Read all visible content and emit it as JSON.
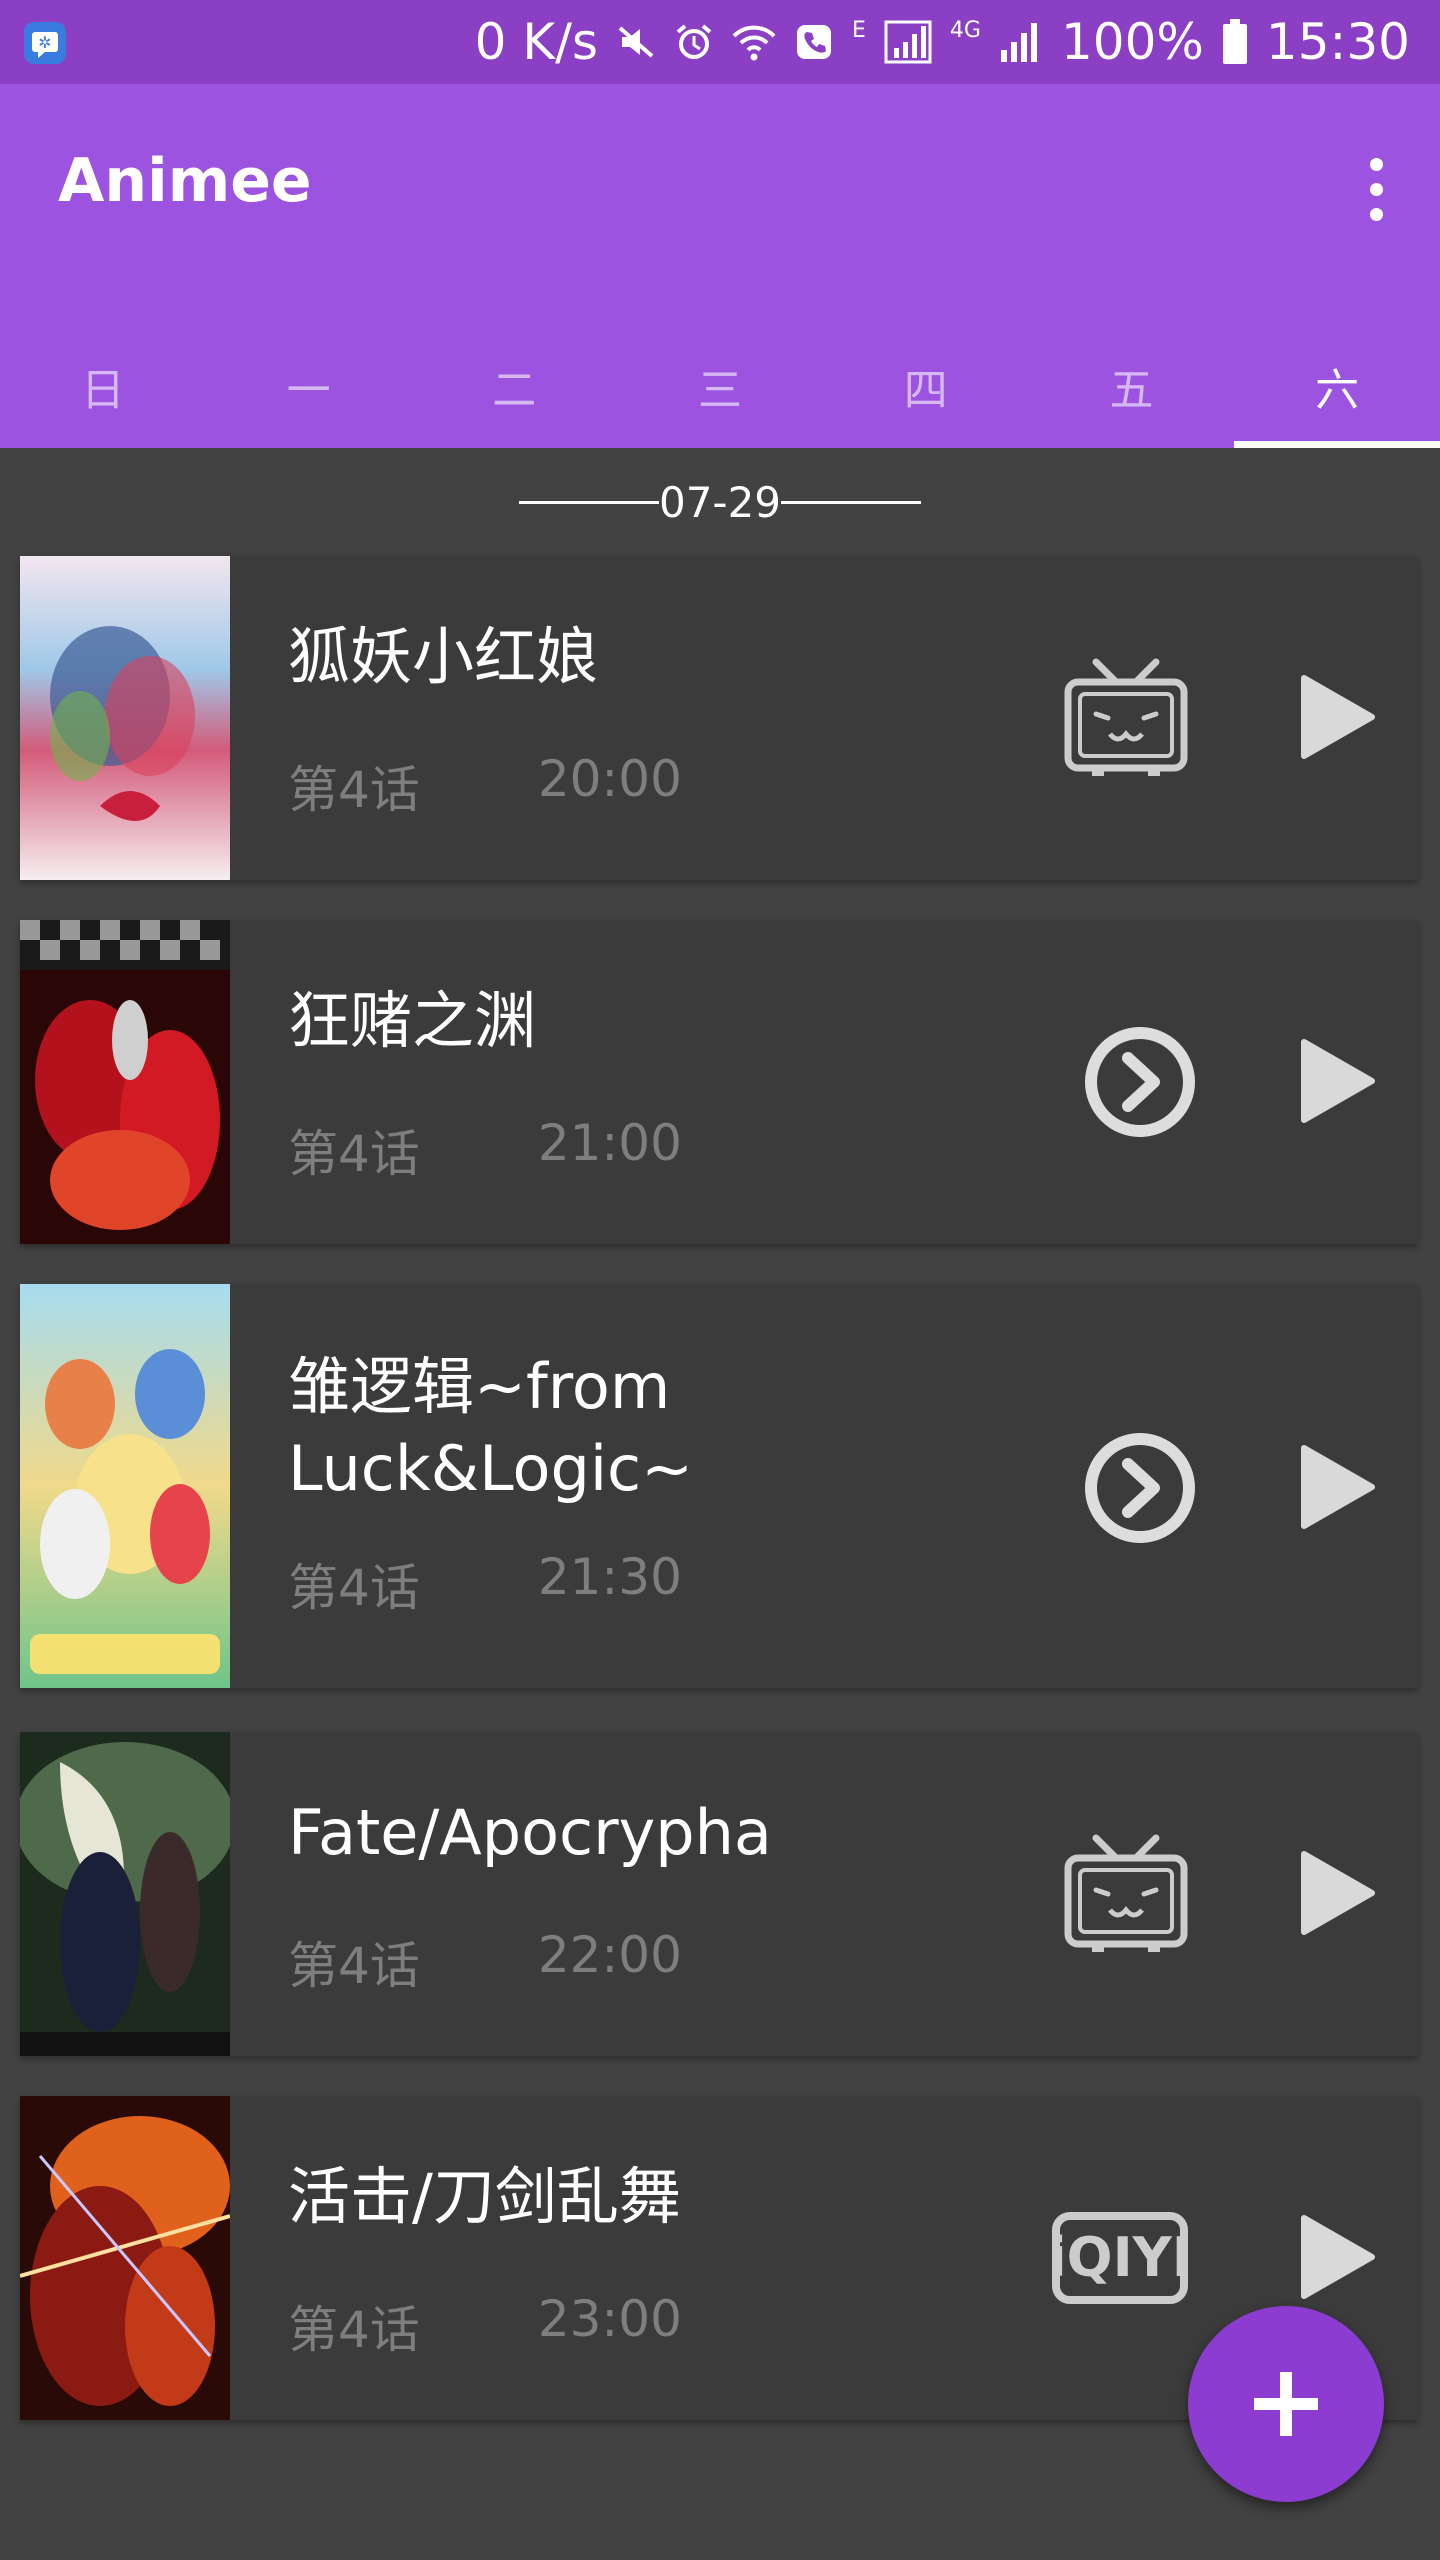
{
  "status_bar": {
    "speed": "0 K/s",
    "network_e": "E",
    "network_4g": "4G",
    "battery": "100%",
    "time": "15:30"
  },
  "app_bar": {
    "title": "Animee",
    "tabs": [
      "日",
      "一",
      "二",
      "三",
      "四",
      "五",
      "六"
    ],
    "active_tab": "六"
  },
  "date_header": "07-29",
  "anime_list": [
    {
      "title": "狐妖小红娘",
      "episode": "第4话",
      "time": "20:00",
      "platform": "bilibili-tv-icon"
    },
    {
      "title": "狂赌之渊",
      "episode": "第4话",
      "time": "21:00",
      "platform": "circle-play-icon"
    },
    {
      "title": "雏逻辑~from Luck&Logic~",
      "episode": "第4话",
      "time": "21:30",
      "platform": "circle-play-icon"
    },
    {
      "title": "Fate/Apocrypha",
      "episode": "第4话",
      "time": "22:00",
      "platform": "bilibili-tv-icon"
    },
    {
      "title": "活击/刀剑乱舞",
      "episode": "第4话",
      "time": "23:00",
      "platform": "iqiyi-logo-icon"
    }
  ],
  "iqiyi_logo_text": "iQIYI",
  "colors": {
    "status_bar": "#8a3fc4",
    "app_bar": "#9c53e0",
    "background": "#424242",
    "card": "#3b3b3b",
    "fab": "#8c3cd0"
  }
}
